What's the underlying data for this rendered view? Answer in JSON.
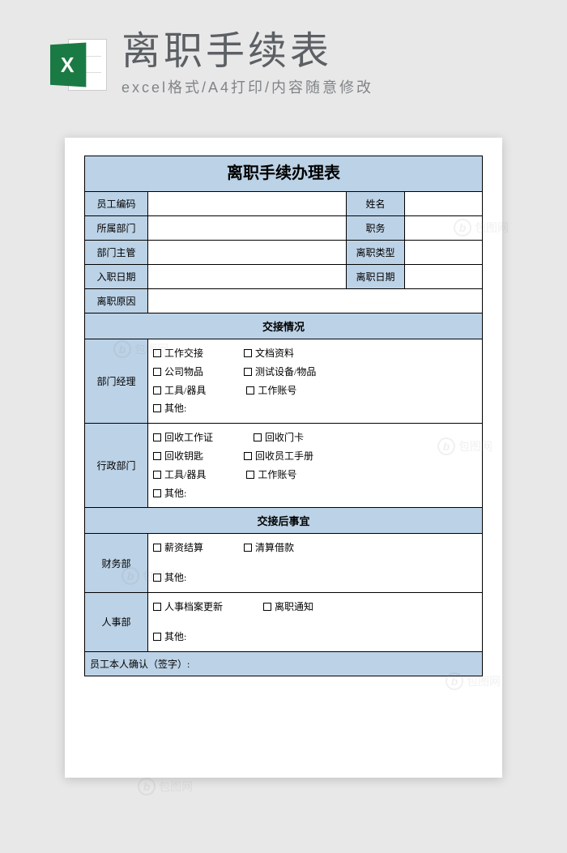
{
  "banner": {
    "icon_letter": "X",
    "title": "离职手续表",
    "subtitle": "excel格式/A4打印/内容随意修改"
  },
  "form": {
    "title": "离职手续办理表",
    "rows": {
      "emp_code_label": "员工编码",
      "name_label": "姓名",
      "dept_label": "所属部门",
      "position_label": "职务",
      "supervisor_label": "部门主管",
      "leave_type_label": "离职类型",
      "hire_date_label": "入职日期",
      "leave_date_label": "离职日期",
      "reason_label": "离职原因"
    },
    "section1_header": "交接情况",
    "dept_manager_label": "部门经理",
    "dept_manager_items": {
      "r1a": "工作交接",
      "r1b": "文档资料",
      "r2a": "公司物品",
      "r2b": "测试设备/物品",
      "r3a": "工具/器具",
      "r3b": "工作账号",
      "r4a": "其他:"
    },
    "admin_label": "行政部门",
    "admin_items": {
      "r1a": "回收工作证",
      "r1b": "回收门卡",
      "r2a": "回收钥匙",
      "r2b": "回收员工手册",
      "r3a": "工具/器具",
      "r3b": "工作账号",
      "r4a": "其他:"
    },
    "section2_header": "交接后事宜",
    "finance_label": "财务部",
    "finance_items": {
      "r1a": "薪资结算",
      "r1b": "清算借款",
      "r2a": "其他:"
    },
    "hr_label": "人事部",
    "hr_items": {
      "r1a": "人事档案更新",
      "r1b": "离职通知",
      "r2a": "其他:"
    },
    "sign_label": "员工本人确认（签字）:"
  },
  "watermark_text": "包图网"
}
